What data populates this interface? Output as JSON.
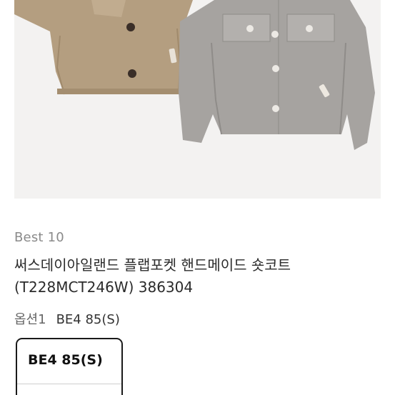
{
  "product": {
    "image_alt": "jacket-photos",
    "badge": "Best 10",
    "title": "써스데이아일랜드 플랩포켓 핸드메이드 숏코트 (T228MCT246W) 386304"
  },
  "option": {
    "label": "옵션1",
    "value": "BE4 85(S)",
    "selected_chip": "BE4 85(S)"
  },
  "colors": {
    "image_bg": "#f3f2f1",
    "jacket_beige": "#b49e80",
    "jacket_gray": "#a6a3a0",
    "chip_border": "#1a1a1a"
  }
}
